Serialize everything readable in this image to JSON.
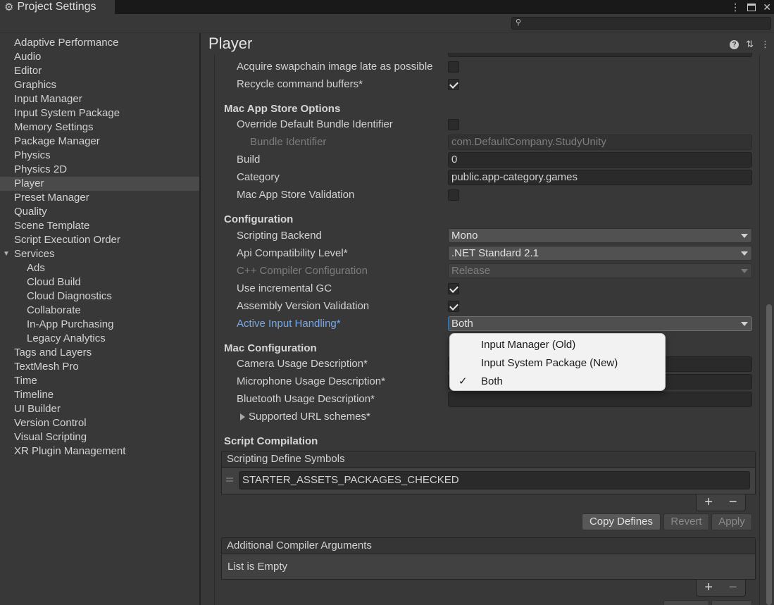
{
  "window": {
    "title": "Project Settings"
  },
  "sidebar": {
    "items": [
      {
        "label": "Adaptive Performance"
      },
      {
        "label": "Audio"
      },
      {
        "label": "Editor"
      },
      {
        "label": "Graphics"
      },
      {
        "label": "Input Manager"
      },
      {
        "label": "Input System Package"
      },
      {
        "label": "Memory Settings"
      },
      {
        "label": "Package Manager"
      },
      {
        "label": "Physics"
      },
      {
        "label": "Physics 2D"
      },
      {
        "label": "Player"
      },
      {
        "label": "Preset Manager"
      },
      {
        "label": "Quality"
      },
      {
        "label": "Scene Template"
      },
      {
        "label": "Script Execution Order"
      },
      {
        "label": "Services"
      },
      {
        "label": "Ads"
      },
      {
        "label": "Cloud Build"
      },
      {
        "label": "Cloud Diagnostics"
      },
      {
        "label": "Collaborate"
      },
      {
        "label": "In-App Purchasing"
      },
      {
        "label": "Legacy Analytics"
      },
      {
        "label": "Tags and Layers"
      },
      {
        "label": "TextMesh Pro"
      },
      {
        "label": "Time"
      },
      {
        "label": "Timeline"
      },
      {
        "label": "UI Builder"
      },
      {
        "label": "Version Control"
      },
      {
        "label": "Visual Scripting"
      },
      {
        "label": "XR Plugin Management"
      }
    ]
  },
  "main": {
    "title": "Player",
    "rows": {
      "acquire_swapchain": "Acquire swapchain image late as possible",
      "recycle_buffers": "Recycle command buffers*"
    },
    "mac_app_store": {
      "heading": "Mac App Store Options",
      "override_bundle": "Override Default Bundle Identifier",
      "bundle_id_label": "Bundle Identifier",
      "bundle_id_value": "com.DefaultCompany.StudyUnity",
      "build_label": "Build",
      "build_value": "0",
      "category_label": "Category",
      "category_value": "public.app-category.games",
      "validation_label": "Mac App Store Validation"
    },
    "configuration": {
      "heading": "Configuration",
      "scripting_backend_label": "Scripting Backend",
      "scripting_backend_value": "Mono",
      "api_level_label": "Api Compatibility Level*",
      "api_level_value": ".NET Standard 2.1",
      "cpp_config_label": "C++ Compiler Configuration",
      "cpp_config_value": "Release",
      "incremental_gc_label": "Use incremental GC",
      "assembly_validation_label": "Assembly Version Validation",
      "input_handling_label": "Active Input Handling*",
      "input_handling_value": "Both"
    },
    "mac_configuration": {
      "heading": "Mac Configuration",
      "camera_label": "Camera Usage Description*",
      "microphone_label": "Microphone Usage Description*",
      "bluetooth_label": "Bluetooth Usage Description*",
      "url_schemes_label": "Supported URL schemes*"
    },
    "script_compilation": {
      "heading": "Script Compilation",
      "define_symbols_header": "Scripting Define Symbols",
      "define_symbol_value": "STARTER_ASSETS_PACKAGES_CHECKED",
      "copy_defines": "Copy Defines",
      "revert": "Revert",
      "apply": "Apply",
      "compiler_args_header": "Additional Compiler Arguments",
      "list_empty": "List is Empty",
      "plus": "+",
      "minus": "−"
    }
  },
  "popup": {
    "options": [
      {
        "label": "Input Manager (Old)",
        "checked": false
      },
      {
        "label": "Input System Package (New)",
        "checked": false
      },
      {
        "label": "Both",
        "checked": true
      }
    ],
    "check_glyph": "✓"
  }
}
